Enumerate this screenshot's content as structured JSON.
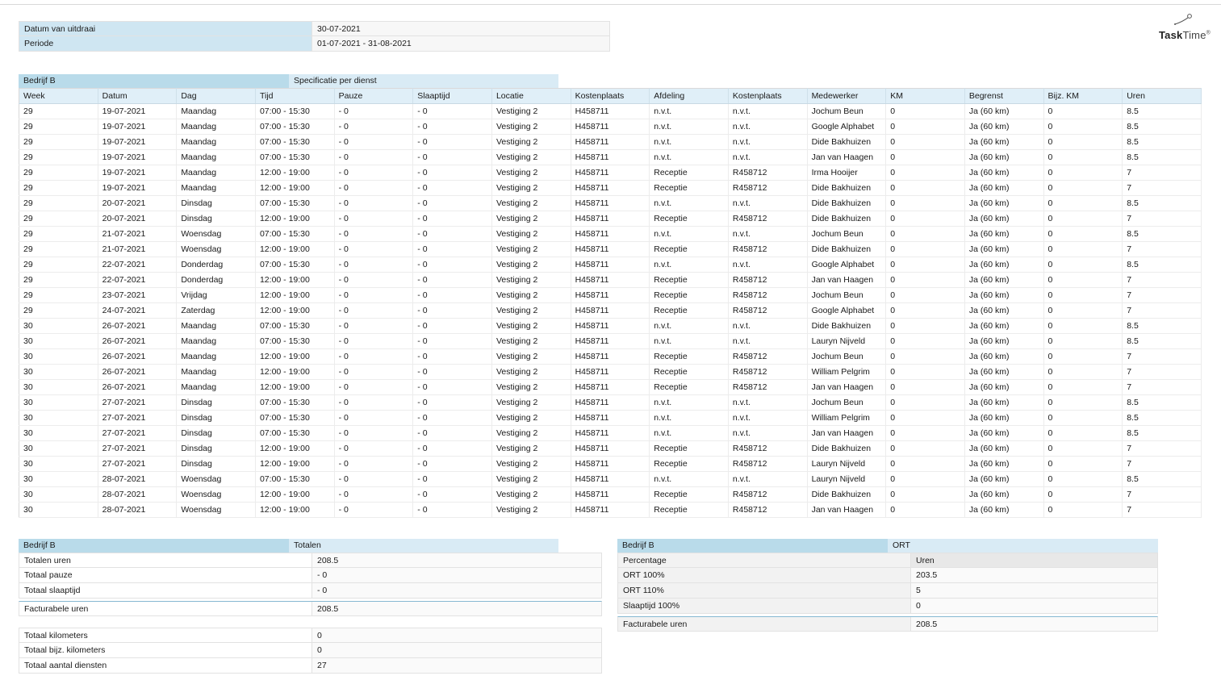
{
  "colors": {
    "band_primary": "#b9dbea",
    "band_secondary": "#d9ebf5",
    "table_header_bg": "#e0eff8",
    "info_label_bg": "#cfe6f2",
    "emphasis_border": "#86b8d2"
  },
  "logo": {
    "bold": "Task",
    "light": "Time",
    "mark": "®"
  },
  "info": {
    "rows": [
      {
        "label": "Datum van uitdraai",
        "value": "30-07-2021"
      },
      {
        "label": "Periode",
        "value": "01-07-2021 - 31-08-2021"
      }
    ]
  },
  "main_table": {
    "band": {
      "left": "Bedrijf B",
      "right": "Specificatie per dienst"
    },
    "columns": [
      "Week",
      "Datum",
      "Dag",
      "Tijd",
      "Pauze",
      "Slaaptijd",
      "Locatie",
      "Kostenplaats",
      "Afdeling",
      "Kostenplaats",
      "Medewerker",
      "KM",
      "Begrenst",
      "Bijz. KM",
      "Uren"
    ],
    "rows": [
      [
        "29",
        "19-07-2021",
        "Maandag",
        "07:00 - 15:30",
        "- 0",
        "- 0",
        "Vestiging 2",
        "H458711",
        "n.v.t.",
        "n.v.t.",
        "Jochum Beun",
        "0",
        "Ja (60 km)",
        "0",
        "8.5"
      ],
      [
        "29",
        "19-07-2021",
        "Maandag",
        "07:00 - 15:30",
        "- 0",
        "- 0",
        "Vestiging 2",
        "H458711",
        "n.v.t.",
        "n.v.t.",
        "Google Alphabet",
        "0",
        "Ja (60 km)",
        "0",
        "8.5"
      ],
      [
        "29",
        "19-07-2021",
        "Maandag",
        "07:00 - 15:30",
        "- 0",
        "- 0",
        "Vestiging 2",
        "H458711",
        "n.v.t.",
        "n.v.t.",
        "Dide Bakhuizen",
        "0",
        "Ja (60 km)",
        "0",
        "8.5"
      ],
      [
        "29",
        "19-07-2021",
        "Maandag",
        "07:00 - 15:30",
        "- 0",
        "- 0",
        "Vestiging 2",
        "H458711",
        "n.v.t.",
        "n.v.t.",
        "Jan van Haagen",
        "0",
        "Ja (60 km)",
        "0",
        "8.5"
      ],
      [
        "29",
        "19-07-2021",
        "Maandag",
        "12:00 - 19:00",
        "- 0",
        "- 0",
        "Vestiging 2",
        "H458711",
        "Receptie",
        "R458712",
        "Irma Hooijer",
        "0",
        "Ja (60 km)",
        "0",
        "7"
      ],
      [
        "29",
        "19-07-2021",
        "Maandag",
        "12:00 - 19:00",
        "- 0",
        "- 0",
        "Vestiging 2",
        "H458711",
        "Receptie",
        "R458712",
        "Dide Bakhuizen",
        "0",
        "Ja (60 km)",
        "0",
        "7"
      ],
      [
        "29",
        "20-07-2021",
        "Dinsdag",
        "07:00 - 15:30",
        "- 0",
        "- 0",
        "Vestiging 2",
        "H458711",
        "n.v.t.",
        "n.v.t.",
        "Dide Bakhuizen",
        "0",
        "Ja (60 km)",
        "0",
        "8.5"
      ],
      [
        "29",
        "20-07-2021",
        "Dinsdag",
        "12:00 - 19:00",
        "- 0",
        "- 0",
        "Vestiging 2",
        "H458711",
        "Receptie",
        "R458712",
        "Dide Bakhuizen",
        "0",
        "Ja (60 km)",
        "0",
        "7"
      ],
      [
        "29",
        "21-07-2021",
        "Woensdag",
        "07:00 - 15:30",
        "- 0",
        "- 0",
        "Vestiging 2",
        "H458711",
        "n.v.t.",
        "n.v.t.",
        "Jochum Beun",
        "0",
        "Ja (60 km)",
        "0",
        "8.5"
      ],
      [
        "29",
        "21-07-2021",
        "Woensdag",
        "12:00 - 19:00",
        "- 0",
        "- 0",
        "Vestiging 2",
        "H458711",
        "Receptie",
        "R458712",
        "Dide Bakhuizen",
        "0",
        "Ja (60 km)",
        "0",
        "7"
      ],
      [
        "29",
        "22-07-2021",
        "Donderdag",
        "07:00 - 15:30",
        "- 0",
        "- 0",
        "Vestiging 2",
        "H458711",
        "n.v.t.",
        "n.v.t.",
        "Google Alphabet",
        "0",
        "Ja (60 km)",
        "0",
        "8.5"
      ],
      [
        "29",
        "22-07-2021",
        "Donderdag",
        "12:00 - 19:00",
        "- 0",
        "- 0",
        "Vestiging 2",
        "H458711",
        "Receptie",
        "R458712",
        "Jan van Haagen",
        "0",
        "Ja (60 km)",
        "0",
        "7"
      ],
      [
        "29",
        "23-07-2021",
        "Vrijdag",
        "12:00 - 19:00",
        "- 0",
        "- 0",
        "Vestiging 2",
        "H458711",
        "Receptie",
        "R458712",
        "Jochum Beun",
        "0",
        "Ja (60 km)",
        "0",
        "7"
      ],
      [
        "29",
        "24-07-2021",
        "Zaterdag",
        "12:00 - 19:00",
        "- 0",
        "- 0",
        "Vestiging 2",
        "H458711",
        "Receptie",
        "R458712",
        "Google Alphabet",
        "0",
        "Ja (60 km)",
        "0",
        "7"
      ],
      [
        "30",
        "26-07-2021",
        "Maandag",
        "07:00 - 15:30",
        "- 0",
        "- 0",
        "Vestiging 2",
        "H458711",
        "n.v.t.",
        "n.v.t.",
        "Dide Bakhuizen",
        "0",
        "Ja (60 km)",
        "0",
        "8.5"
      ],
      [
        "30",
        "26-07-2021",
        "Maandag",
        "07:00 - 15:30",
        "- 0",
        "- 0",
        "Vestiging 2",
        "H458711",
        "n.v.t.",
        "n.v.t.",
        "Lauryn Nijveld",
        "0",
        "Ja (60 km)",
        "0",
        "8.5"
      ],
      [
        "30",
        "26-07-2021",
        "Maandag",
        "12:00 - 19:00",
        "- 0",
        "- 0",
        "Vestiging 2",
        "H458711",
        "Receptie",
        "R458712",
        "Jochum Beun",
        "0",
        "Ja (60 km)",
        "0",
        "7"
      ],
      [
        "30",
        "26-07-2021",
        "Maandag",
        "12:00 - 19:00",
        "- 0",
        "- 0",
        "Vestiging 2",
        "H458711",
        "Receptie",
        "R458712",
        "William Pelgrim",
        "0",
        "Ja (60 km)",
        "0",
        "7"
      ],
      [
        "30",
        "26-07-2021",
        "Maandag",
        "12:00 - 19:00",
        "- 0",
        "- 0",
        "Vestiging 2",
        "H458711",
        "Receptie",
        "R458712",
        "Jan van Haagen",
        "0",
        "Ja (60 km)",
        "0",
        "7"
      ],
      [
        "30",
        "27-07-2021",
        "Dinsdag",
        "07:00 - 15:30",
        "- 0",
        "- 0",
        "Vestiging 2",
        "H458711",
        "n.v.t.",
        "n.v.t.",
        "Jochum Beun",
        "0",
        "Ja (60 km)",
        "0",
        "8.5"
      ],
      [
        "30",
        "27-07-2021",
        "Dinsdag",
        "07:00 - 15:30",
        "- 0",
        "- 0",
        "Vestiging 2",
        "H458711",
        "n.v.t.",
        "n.v.t.",
        "William Pelgrim",
        "0",
        "Ja (60 km)",
        "0",
        "8.5"
      ],
      [
        "30",
        "27-07-2021",
        "Dinsdag",
        "07:00 - 15:30",
        "- 0",
        "- 0",
        "Vestiging 2",
        "H458711",
        "n.v.t.",
        "n.v.t.",
        "Jan van Haagen",
        "0",
        "Ja (60 km)",
        "0",
        "8.5"
      ],
      [
        "30",
        "27-07-2021",
        "Dinsdag",
        "12:00 - 19:00",
        "- 0",
        "- 0",
        "Vestiging 2",
        "H458711",
        "Receptie",
        "R458712",
        "Dide Bakhuizen",
        "0",
        "Ja (60 km)",
        "0",
        "7"
      ],
      [
        "30",
        "27-07-2021",
        "Dinsdag",
        "12:00 - 19:00",
        "- 0",
        "- 0",
        "Vestiging 2",
        "H458711",
        "Receptie",
        "R458712",
        "Lauryn Nijveld",
        "0",
        "Ja (60 km)",
        "0",
        "7"
      ],
      [
        "30",
        "28-07-2021",
        "Woensdag",
        "07:00 - 15:30",
        "- 0",
        "- 0",
        "Vestiging 2",
        "H458711",
        "n.v.t.",
        "n.v.t.",
        "Lauryn Nijveld",
        "0",
        "Ja (60 km)",
        "0",
        "8.5"
      ],
      [
        "30",
        "28-07-2021",
        "Woensdag",
        "12:00 - 19:00",
        "- 0",
        "- 0",
        "Vestiging 2",
        "H458711",
        "Receptie",
        "R458712",
        "Dide Bakhuizen",
        "0",
        "Ja (60 km)",
        "0",
        "7"
      ],
      [
        "30",
        "28-07-2021",
        "Woensdag",
        "12:00 - 19:00",
        "- 0",
        "- 0",
        "Vestiging 2",
        "H458711",
        "Receptie",
        "R458712",
        "Jan van Haagen",
        "0",
        "Ja (60 km)",
        "0",
        "7"
      ]
    ]
  },
  "totals_table": {
    "band": {
      "left": "Bedrijf B",
      "right": "Totalen"
    },
    "rows": [
      {
        "label": "Totalen uren",
        "value": "208.5"
      },
      {
        "label": "Totaal pauze",
        "value": "- 0"
      },
      {
        "label": "Totaal slaaptijd",
        "value": "- 0"
      },
      {
        "label": "Facturabele uren",
        "value": "208.5",
        "emphasis": true
      }
    ]
  },
  "extra_totals": {
    "rows": [
      {
        "label": "Totaal kilometers",
        "value": "0"
      },
      {
        "label": "Totaal bijz. kilometers",
        "value": "0"
      },
      {
        "label": "Totaal aantal diensten",
        "value": "27"
      }
    ]
  },
  "ort_table": {
    "band": {
      "left": "Bedrijf B",
      "right": "ORT"
    },
    "rows": [
      {
        "label": "Percentage",
        "value": "Uren",
        "header": true
      },
      {
        "label": "ORT 100%",
        "value": "203.5"
      },
      {
        "label": "ORT 110%",
        "value": "5"
      },
      {
        "label": "Slaaptijd 100%",
        "value": "0"
      },
      {
        "label": "Facturabele uren",
        "value": "208.5",
        "emphasis": true
      }
    ]
  }
}
